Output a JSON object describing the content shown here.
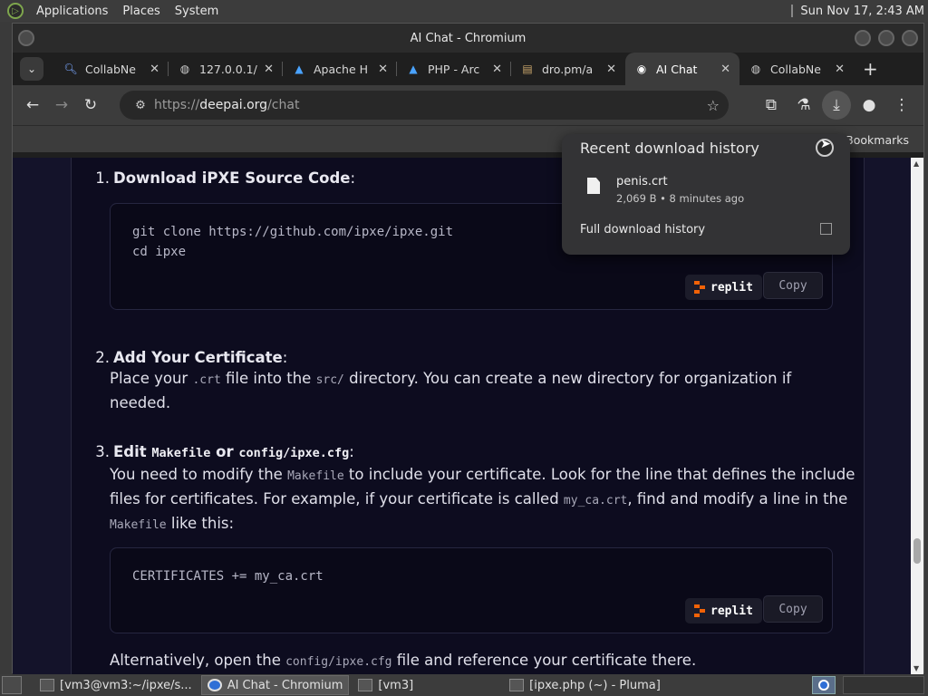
{
  "system_panel": {
    "menus": [
      "Applications",
      "Places",
      "System"
    ],
    "clock": "Sun Nov 17,  2:43 AM"
  },
  "window": {
    "title": "AI Chat - Chromium"
  },
  "tabs": [
    {
      "label": "CollabNe",
      "icon": "search-icon"
    },
    {
      "label": "127.0.0.1/",
      "icon": "globe-icon"
    },
    {
      "label": "Apache H",
      "icon": "arch-logo-icon"
    },
    {
      "label": "PHP - Arc",
      "icon": "arch-logo-icon"
    },
    {
      "label": "dro.pm/a",
      "icon": "folder-icon"
    },
    {
      "label": "AI Chat",
      "icon": "deepai-icon",
      "active": true
    },
    {
      "label": "CollabNe",
      "icon": "globe-icon"
    }
  ],
  "omnibox": {
    "scheme": "https://",
    "host": "deepai.org",
    "path": "/chat"
  },
  "bookmarks": {
    "all_bookmarks": "Bookmarks"
  },
  "download_popup": {
    "title": "Recent download history",
    "file_name": "penis.crt",
    "file_meta": "2,069 B • 8 minutes ago",
    "full_history": "Full download history"
  },
  "chat": {
    "step1": {
      "num": "1.",
      "title": "Download iPXE Source Code",
      "suffix": ":"
    },
    "code1": "git clone https://github.com/ipxe/ipxe.git\ncd ipxe",
    "step2": {
      "num": "2.",
      "title": "Add Your Certificate",
      "suffix": ":",
      "text_a": "Place your ",
      "code_a": ".crt",
      "text_b": " file into the ",
      "code_b": "src/",
      "text_c": " directory. You can create a new directory for organization if",
      "text_d": "needed."
    },
    "step3": {
      "num": "3.",
      "title_a": "Edit ",
      "code_a": "Makefile",
      "title_b": " or ",
      "code_b": "config/ipxe.cfg",
      "suffix": ":",
      "l1_a": "You need to modify the ",
      "l1_code": "Makefile",
      "l1_b": " to include your certificate. Look for the line that defines the include",
      "l2_a": "files for certificates. For example, if your certificate is called ",
      "l2_code": "my_ca.crt",
      "l2_b": ", find and modify a line in the",
      "l3_code": "Makefile",
      "l3_b": " like this:"
    },
    "code2": "CERTIFICATES += my_ca.crt",
    "alt_a": "Alternatively, open the ",
    "alt_code": "config/ipxe.cfg",
    "alt_b": " file and reference your certificate there.",
    "replit_label": "replit",
    "copy_label": "Copy"
  },
  "taskbar": {
    "items": [
      {
        "label": "[vm3@vm3:~/ipxe/s...",
        "icon": "terminal-icon"
      },
      {
        "label": "AI Chat - Chromium",
        "icon": "chromium-icon",
        "active": true
      },
      {
        "label": "[vm3]",
        "icon": "folder-icon"
      },
      {
        "label": "[ipxe.php (~) - Pluma]",
        "icon": "text-editor-icon"
      }
    ]
  }
}
